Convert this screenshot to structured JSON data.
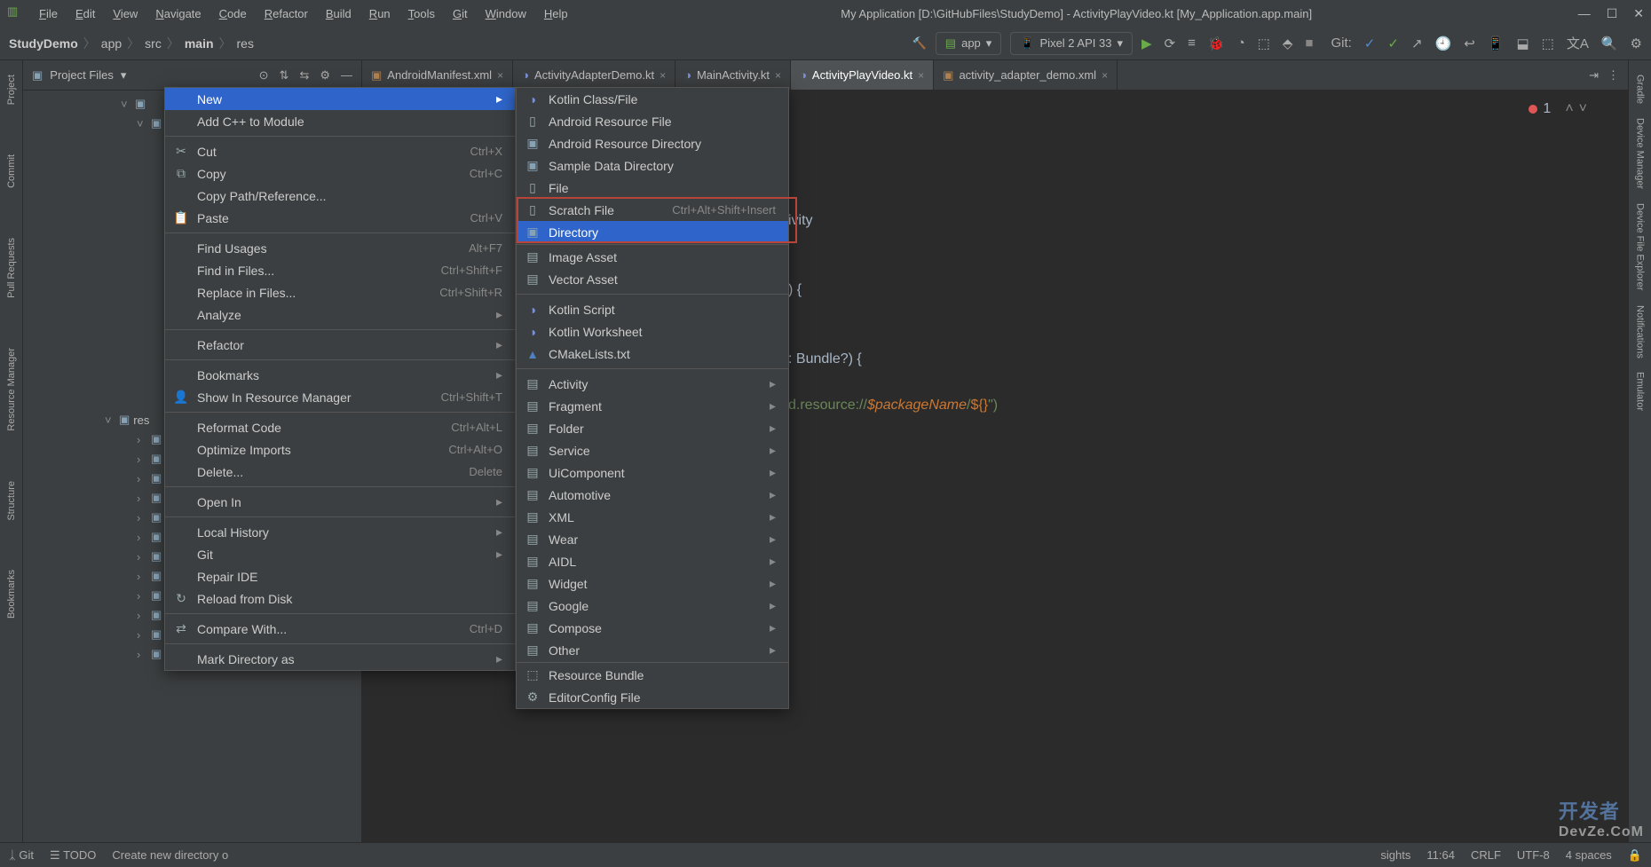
{
  "window": {
    "title": "My Application [D:\\GitHubFiles\\StudyDemo] - ActivityPlayVideo.kt [My_Application.app.main]"
  },
  "menubar": [
    "File",
    "Edit",
    "View",
    "Navigate",
    "Code",
    "Refactor",
    "Build",
    "Run",
    "Tools",
    "Git",
    "Window",
    "Help"
  ],
  "breadcrumb": [
    "StudyDemo",
    "app",
    "src",
    "main",
    "res"
  ],
  "toolbar": {
    "config": "app",
    "device": "Pixel 2 API 33",
    "git_label": "Git:"
  },
  "sidepanel": {
    "title": "Project Files",
    "res_label": "res"
  },
  "tabs": [
    {
      "label": "AndroidManifest.xml",
      "icon": "xml",
      "active": false
    },
    {
      "label": "ActivityAdapterDemo.kt",
      "icon": "kt",
      "active": false
    },
    {
      "label": "MainActivity.kt",
      "icon": "kt",
      "active": false
    },
    {
      "label": "ActivityPlayVideo.kt",
      "icon": "kt",
      "active": true
    },
    {
      "label": "activity_adapter_demo.xml",
      "icon": "xml",
      "active": false
    }
  ],
  "code": {
    "error_count": "1",
    "line1": "ivity",
    "line2": ") {",
    "line3": ": Bundle?) {",
    "line4a": "d.resource://",
    "line4b": "$packageName",
    "line4c": "/",
    "line4d": "${}",
    "line4e": "\")"
  },
  "context1": [
    {
      "label": "New",
      "shortcut": "",
      "arrow": true,
      "selected": true,
      "icon": ""
    },
    {
      "label": "Add C++ to Module",
      "shortcut": "",
      "icon": ""
    },
    {
      "sep": true
    },
    {
      "label": "Cut",
      "shortcut": "Ctrl+X",
      "icon": "✂"
    },
    {
      "label": "Copy",
      "shortcut": "Ctrl+C",
      "icon": "⧉"
    },
    {
      "label": "Copy Path/Reference...",
      "shortcut": "",
      "icon": ""
    },
    {
      "label": "Paste",
      "shortcut": "Ctrl+V",
      "icon": "📋"
    },
    {
      "sep": true
    },
    {
      "label": "Find Usages",
      "shortcut": "Alt+F7",
      "icon": ""
    },
    {
      "label": "Find in Files...",
      "shortcut": "Ctrl+Shift+F",
      "icon": ""
    },
    {
      "label": "Replace in Files...",
      "shortcut": "Ctrl+Shift+R",
      "icon": ""
    },
    {
      "label": "Analyze",
      "shortcut": "",
      "arrow": true,
      "icon": ""
    },
    {
      "sep": true
    },
    {
      "label": "Refactor",
      "shortcut": "",
      "arrow": true,
      "icon": ""
    },
    {
      "sep": true
    },
    {
      "label": "Bookmarks",
      "shortcut": "",
      "arrow": true,
      "icon": ""
    },
    {
      "label": "Show In Resource Manager",
      "shortcut": "Ctrl+Shift+T",
      "icon": "👤"
    },
    {
      "sep": true
    },
    {
      "label": "Reformat Code",
      "shortcut": "Ctrl+Alt+L",
      "icon": ""
    },
    {
      "label": "Optimize Imports",
      "shortcut": "Ctrl+Alt+O",
      "icon": ""
    },
    {
      "label": "Delete...",
      "shortcut": "Delete",
      "icon": ""
    },
    {
      "sep": true
    },
    {
      "label": "Open In",
      "shortcut": "",
      "arrow": true,
      "icon": ""
    },
    {
      "sep": true
    },
    {
      "label": "Local History",
      "shortcut": "",
      "arrow": true,
      "icon": ""
    },
    {
      "label": "Git",
      "shortcut": "",
      "arrow": true,
      "icon": ""
    },
    {
      "label": "Repair IDE",
      "shortcut": "",
      "icon": ""
    },
    {
      "label": "Reload from Disk",
      "shortcut": "",
      "icon": "↻"
    },
    {
      "sep": true
    },
    {
      "label": "Compare With...",
      "shortcut": "Ctrl+D",
      "icon": "⇄"
    },
    {
      "sep": true
    },
    {
      "label": "Mark Directory as",
      "shortcut": "",
      "arrow": true,
      "icon": ""
    }
  ],
  "context2": [
    {
      "label": "Kotlin Class/File",
      "icon": "kt"
    },
    {
      "label": "Android Resource File",
      "icon": "file"
    },
    {
      "label": "Android Resource Directory",
      "icon": "folder"
    },
    {
      "label": "Sample Data Directory",
      "icon": "folder"
    },
    {
      "label": "File",
      "icon": "file"
    },
    {
      "label": "Scratch File",
      "shortcut": "Ctrl+Alt+Shift+Insert",
      "icon": "file"
    },
    {
      "label": "Directory",
      "icon": "folder",
      "selected": true
    },
    {
      "sep": true,
      "tight": true
    },
    {
      "label": "Image Asset",
      "icon": "android"
    },
    {
      "label": "Vector Asset",
      "icon": "android"
    },
    {
      "sep": true
    },
    {
      "label": "Kotlin Script",
      "icon": "kt"
    },
    {
      "label": "Kotlin Worksheet",
      "icon": "kt"
    },
    {
      "label": "CMakeLists.txt",
      "icon": "tri"
    },
    {
      "sep": true
    },
    {
      "label": "Activity",
      "icon": "android",
      "arrow": true
    },
    {
      "label": "Fragment",
      "icon": "android",
      "arrow": true
    },
    {
      "label": "Folder",
      "icon": "android",
      "arrow": true
    },
    {
      "label": "Service",
      "icon": "android",
      "arrow": true
    },
    {
      "label": "UiComponent",
      "icon": "android",
      "arrow": true
    },
    {
      "label": "Automotive",
      "icon": "android",
      "arrow": true
    },
    {
      "label": "XML",
      "icon": "android",
      "arrow": true
    },
    {
      "label": "Wear",
      "icon": "android",
      "arrow": true
    },
    {
      "label": "AIDL",
      "icon": "android",
      "arrow": true
    },
    {
      "label": "Widget",
      "icon": "android",
      "arrow": true
    },
    {
      "label": "Google",
      "icon": "android",
      "arrow": true
    },
    {
      "label": "Compose",
      "icon": "android",
      "arrow": true
    },
    {
      "label": "Other",
      "icon": "android",
      "arrow": true
    },
    {
      "sep": true,
      "tight": true
    },
    {
      "label": "Resource Bundle",
      "icon": "res"
    },
    {
      "label": "EditorConfig File",
      "icon": "cfg"
    }
  ],
  "left_tools": [
    "Project",
    "Commit",
    "Pull Requests",
    "Resource Manager",
    "Structure",
    "Bookmarks"
  ],
  "right_tools": [
    "Gradle",
    "Device Manager",
    "Device File Explorer",
    "Notifications",
    "Emulator"
  ],
  "statusbar": {
    "left1": "Git",
    "left2": "TODO",
    "hint": "Create new directory o",
    "right_hint": "sights",
    "pos": "11:64",
    "eol": "CRLF",
    "enc": "UTF-8",
    "indent": "4 spaces"
  },
  "watermark": {
    "top": "开发者",
    "bottom": "DevZe.CoM"
  }
}
